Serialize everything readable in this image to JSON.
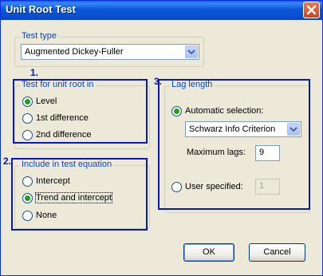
{
  "window": {
    "title": "Unit Root Test"
  },
  "test_type": {
    "legend": "Test type",
    "selected": "Augmented Dickey-Fuller"
  },
  "unit_root": {
    "number": "1.",
    "legend": "Test for unit root in",
    "options": [
      {
        "label": "Level",
        "selected": true
      },
      {
        "label": "1st difference",
        "selected": false
      },
      {
        "label": "2nd difference",
        "selected": false
      }
    ]
  },
  "equation": {
    "number": "2.",
    "legend": "Include in test equation",
    "options": [
      {
        "label": "Intercept",
        "selected": false
      },
      {
        "label": "Trend and intercept",
        "selected": true
      },
      {
        "label": "None",
        "selected": false
      }
    ]
  },
  "lag": {
    "number": "3.",
    "legend": "Lag length",
    "automatic_label": "Automatic selection:",
    "criterion": "Schwarz Info Criterion",
    "max_lags_label": "Maximum lags:",
    "max_lags_value": "9",
    "user_label": "User specified:",
    "user_value": "1"
  },
  "buttons": {
    "ok": "OK",
    "cancel": "Cancel"
  },
  "colors": {
    "annotation": "#0a19b5",
    "title_bar": "#0a5fe6",
    "close": "#c9461e"
  }
}
